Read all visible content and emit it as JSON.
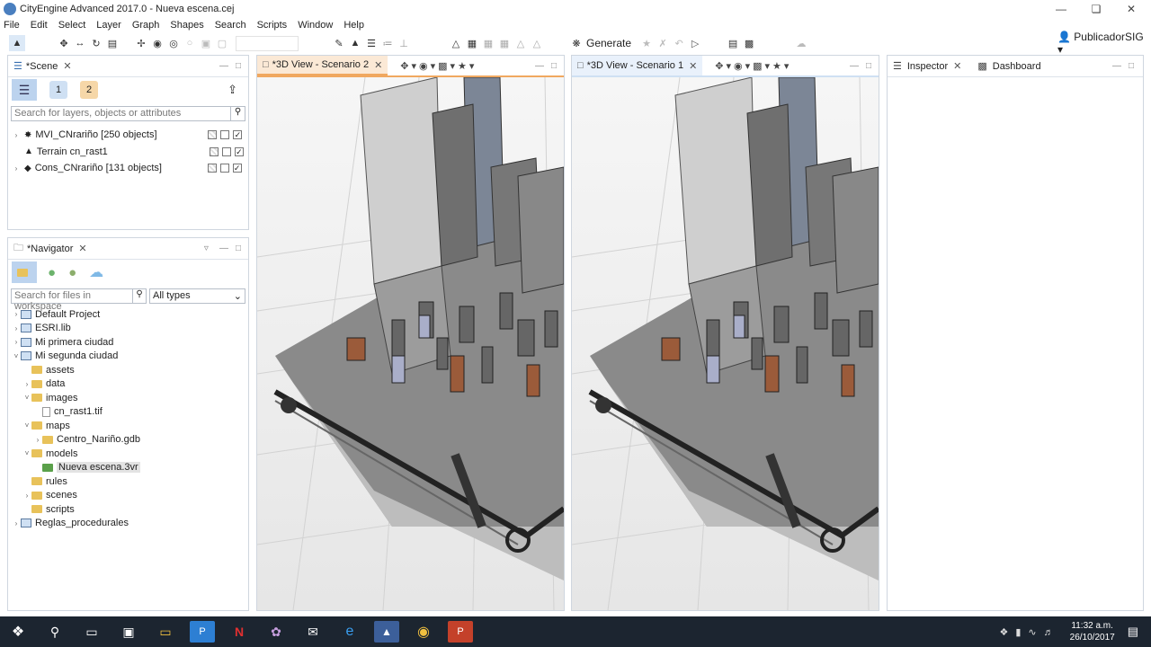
{
  "window": {
    "title": "CityEngine Advanced 2017.0 - Nueva escena.cej"
  },
  "menu": [
    "File",
    "Edit",
    "Select",
    "Layer",
    "Graph",
    "Shapes",
    "Search",
    "Scripts",
    "Window",
    "Help"
  ],
  "toolbar": {
    "generate_label": "Generate",
    "user_label": "PublicadorSIG"
  },
  "scene": {
    "tab_label": "*Scene",
    "layer_num1": "1",
    "layer_num2": "2",
    "search_placeholder": "Search for layers, objects or attributes",
    "layers": [
      {
        "label": "MVI_CNrariño [250 objects]",
        "visible": true
      },
      {
        "label": "Terrain cn_rast1",
        "visible": true
      },
      {
        "label": "Cons_CNrariño [131 objects]",
        "visible": true
      }
    ]
  },
  "navigator": {
    "tab_label": "*Navigator",
    "search_placeholder": "Search for files in workspace",
    "type_filter": "All types",
    "tree": [
      {
        "label": "Default Project",
        "kind": "project",
        "level": 0,
        "expand": "closed"
      },
      {
        "label": "ESRI.lib",
        "kind": "project",
        "level": 0,
        "expand": "closed"
      },
      {
        "label": "Mi primera ciudad",
        "kind": "project",
        "level": 0,
        "expand": "closed"
      },
      {
        "label": "Mi segunda ciudad",
        "kind": "project",
        "level": 0,
        "expand": "open"
      },
      {
        "label": "assets",
        "kind": "folder",
        "level": 1,
        "expand": "none"
      },
      {
        "label": "data",
        "kind": "folder",
        "level": 1,
        "expand": "closed"
      },
      {
        "label": "images",
        "kind": "folder",
        "level": 1,
        "expand": "open"
      },
      {
        "label": "cn_rast1.tif",
        "kind": "file",
        "level": 2,
        "expand": "none"
      },
      {
        "label": "maps",
        "kind": "folder",
        "level": 1,
        "expand": "open"
      },
      {
        "label": "Centro_Nariño.gdb",
        "kind": "folder",
        "level": 2,
        "expand": "closed"
      },
      {
        "label": "models",
        "kind": "folder",
        "level": 1,
        "expand": "open"
      },
      {
        "label": "Nueva escena.3vr",
        "kind": "model",
        "level": 2,
        "expand": "none",
        "selected": true
      },
      {
        "label": "rules",
        "kind": "folder",
        "level": 1,
        "expand": "none"
      },
      {
        "label": "scenes",
        "kind": "folder",
        "level": 1,
        "expand": "closed"
      },
      {
        "label": "scripts",
        "kind": "folder",
        "level": 1,
        "expand": "none"
      },
      {
        "label": "Reglas_procedurales",
        "kind": "project",
        "level": 0,
        "expand": "closed"
      }
    ]
  },
  "views": {
    "view2_label": "*3D View - Scenario 2",
    "view1_label": "*3D View - Scenario 1"
  },
  "inspector": {
    "tab_label": "Inspector",
    "dashboard_label": "Dashboard"
  },
  "taskbar": {
    "time": "11:32 a.m.",
    "date": "26/10/2017"
  },
  "colors": {
    "accent": "#4a90d9",
    "taskbar": "#1c2530",
    "active_tab": "#fbe9d6"
  }
}
